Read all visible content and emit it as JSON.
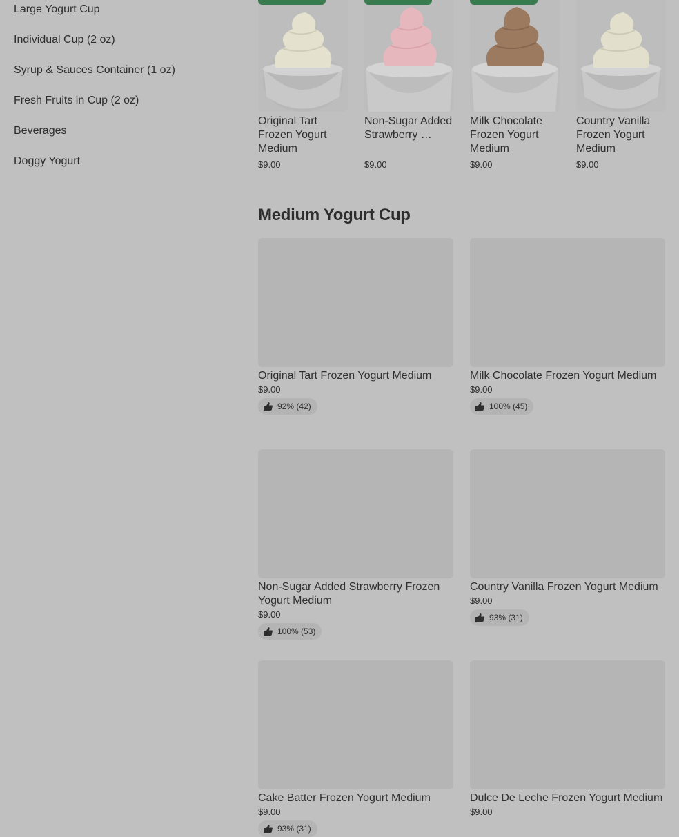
{
  "sidebar": {
    "items": [
      {
        "label": "Large Yogurt Cup"
      },
      {
        "label": "Individual Cup (2 oz)"
      },
      {
        "label": "Syrup & Sauces Container (1 oz)"
      },
      {
        "label": "Fresh Fruits in Cup (2 oz)"
      },
      {
        "label": "Beverages"
      },
      {
        "label": "Doggy Yogurt"
      }
    ]
  },
  "featured": {
    "items": [
      {
        "title": "Original Tart Frozen Yogurt Medium",
        "price": "$9.00"
      },
      {
        "title": "Non-Sugar Added Strawberry …",
        "price": "$9.00"
      },
      {
        "title": "Milk Chocolate Frozen Yogurt Medium",
        "price": "$9.00"
      },
      {
        "title": "Country Vanilla Frozen Yogurt Medium",
        "price": "$9.00"
      }
    ]
  },
  "section": {
    "title": "Medium Yogurt Cup"
  },
  "products": [
    {
      "title": "Original Tart Frozen Yogurt Medium",
      "price": "$9.00",
      "rating": "92% (42)"
    },
    {
      "title": "Milk Chocolate Frozen Yogurt Medium",
      "price": "$9.00",
      "rating": "100% (45)"
    },
    {
      "title": "Non-Sugar Added Strawberry Frozen Yogurt Medium",
      "price": "$9.00",
      "rating": "100% (53)"
    },
    {
      "title": "Country Vanilla Frozen Yogurt Medium",
      "price": "$9.00",
      "rating": "93% (31)"
    },
    {
      "title": "Cake Batter  Frozen Yogurt Medium",
      "price": "$9.00",
      "rating": "93% (31)"
    },
    {
      "title": "Dulce De Leche Frozen Yogurt Medium",
      "price": "$9.00",
      "rating": ""
    }
  ],
  "icons": {
    "rating": "thumbs-up-icon",
    "badge": "featured-badge"
  },
  "colors": {
    "background": "#c0c0c0",
    "badge": "#3a7a4f",
    "image_placeholder": "#b5b5b5"
  }
}
